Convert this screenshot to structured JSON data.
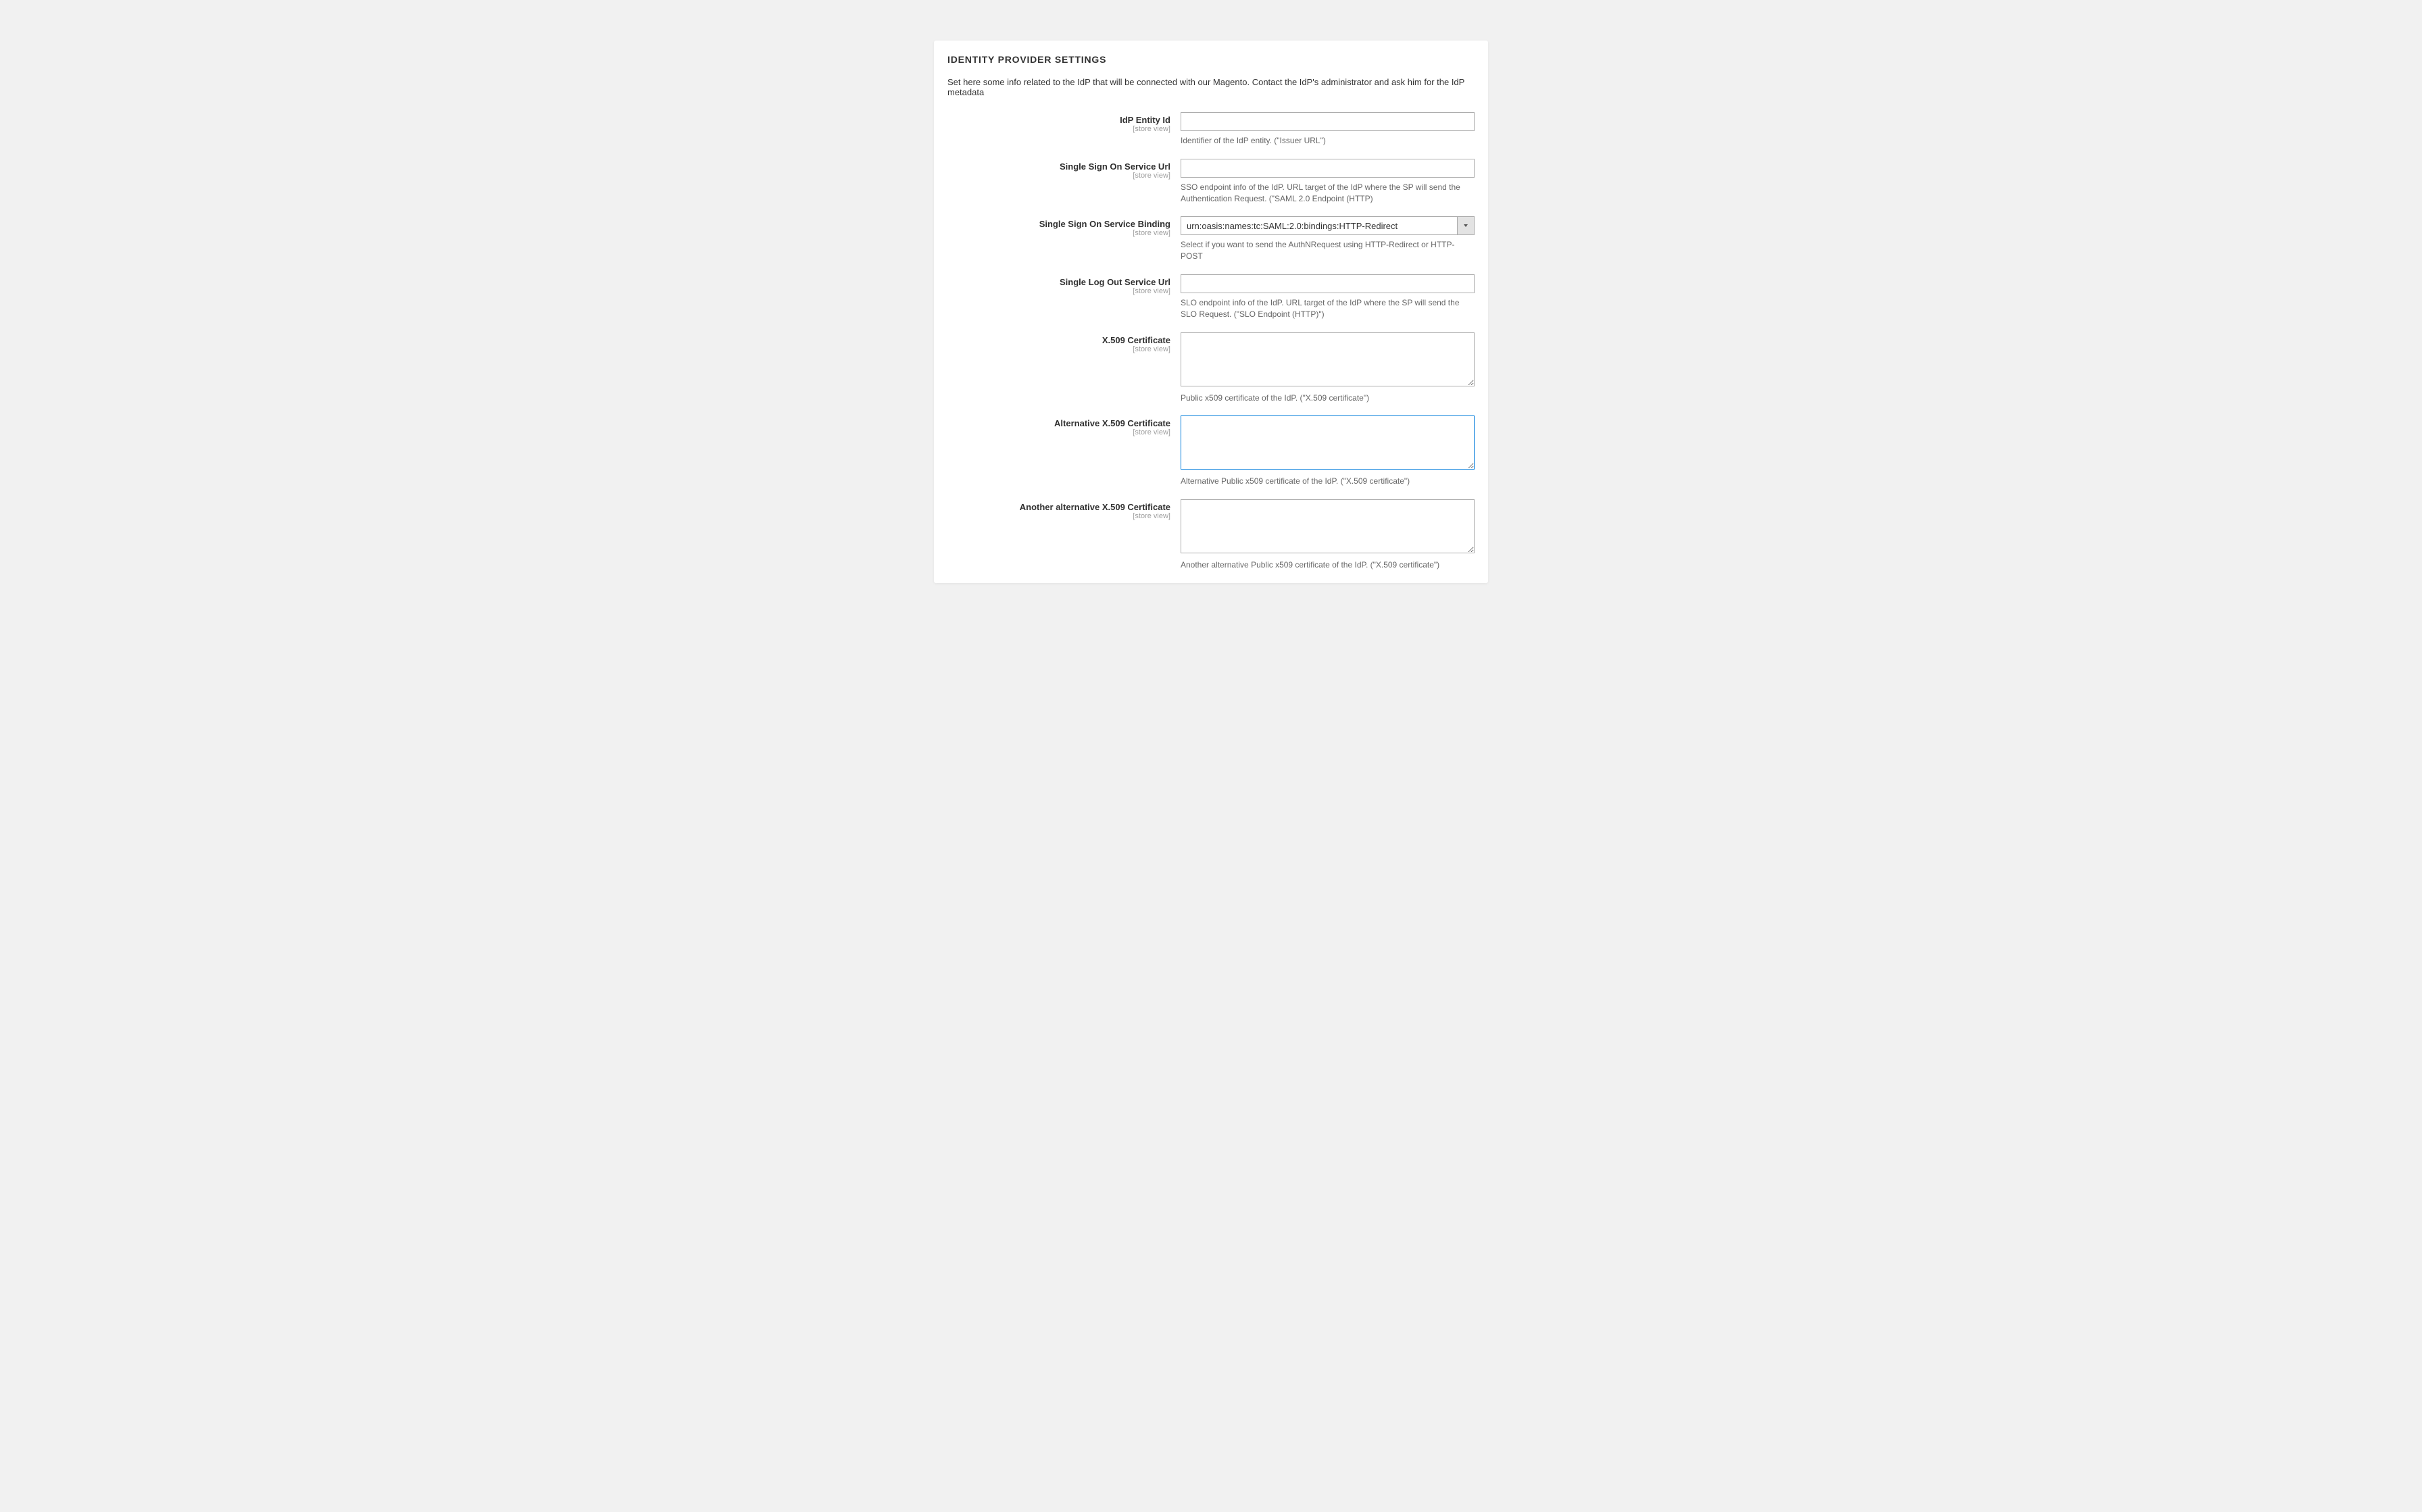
{
  "panel": {
    "title": "IDENTITY PROVIDER SETTINGS",
    "description": "Set here some info related to the IdP that will be connected with our Magento. Contact the IdP's administrator and ask him for the IdP metadata"
  },
  "scope_label": "[store view]",
  "fields": {
    "idp_entity_id": {
      "label": "IdP Entity Id",
      "value": "",
      "help": "Identifier of the IdP entity. (\"Issuer URL\")"
    },
    "sso_url": {
      "label": "Single Sign On Service Url",
      "value": "",
      "help": "SSO endpoint info of the IdP. URL target of the IdP where the SP will send the Authentication Request. (\"SAML 2.0 Endpoint (HTTP)"
    },
    "sso_binding": {
      "label": "Single Sign On Service Binding",
      "value": "urn:oasis:names:tc:SAML:2.0:bindings:HTTP-Redirect",
      "help": "Select if you want to send the AuthNRequest using HTTP-Redirect or HTTP-POST"
    },
    "slo_url": {
      "label": "Single Log Out Service Url",
      "value": "",
      "help": "SLO endpoint info of the IdP. URL target of the IdP where the SP will send the SLO Request. (\"SLO Endpoint (HTTP)\")"
    },
    "x509_cert": {
      "label": "X.509 Certificate",
      "value": "",
      "help": "Public x509 certificate of the IdP. (\"X.509 certificate\")"
    },
    "alt_x509_cert": {
      "label": "Alternative X.509 Certificate",
      "value": "",
      "help": "Alternative Public x509 certificate of the IdP. (\"X.509 certificate\")"
    },
    "another_alt_x509_cert": {
      "label": "Another alternative X.509 Certificate",
      "value": "",
      "help": "Another alternative Public x509 certificate of the IdP. (\"X.509 certificate\")"
    }
  }
}
